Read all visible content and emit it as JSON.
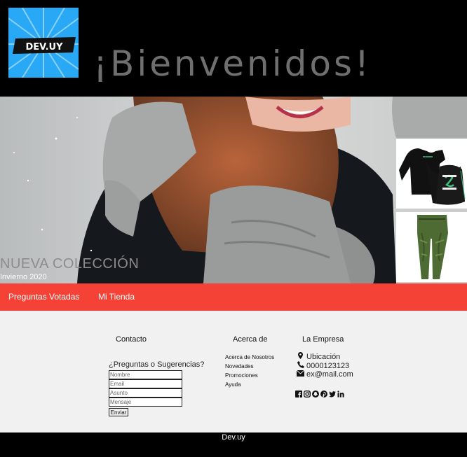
{
  "header": {
    "logo_text": "DEV.UY",
    "welcome": "¡Bienvenidos!"
  },
  "hero": {
    "title": "NUEVA COLECCIÓN",
    "subtitle": "Invierno 2020"
  },
  "nav": {
    "items": [
      {
        "label": "Preguntas Votadas"
      },
      {
        "label": "Mi Tienda"
      }
    ]
  },
  "footer": {
    "contact": {
      "title": "Contacto",
      "prompt": "¿Preguntas o Sugerencias?",
      "fields": [
        {
          "placeholder": "Nombre"
        },
        {
          "placeholder": "Email"
        },
        {
          "placeholder": "Asunto"
        },
        {
          "placeholder": "Mensaje"
        }
      ],
      "submit": "Enviar"
    },
    "about": {
      "title": "Acerca de",
      "links": [
        "Acerca de Nosotros",
        "Novedades",
        "Promociones",
        "Ayuda"
      ]
    },
    "company": {
      "title": "La Empresa",
      "location": "Ubicación",
      "phone": "0000123123",
      "email": "ex@mail.com",
      "social_icons": [
        "facebook-icon",
        "instagram-icon",
        "snapchat-icon",
        "pinterest-icon",
        "twitter-icon",
        "linkedin-icon"
      ]
    }
  },
  "bottom_bar": {
    "text": "Dev.uy"
  },
  "colors": {
    "logo_bg": "#29a9f5",
    "nav_bg": "#f44336",
    "footer_bg": "#f1f1f1"
  }
}
